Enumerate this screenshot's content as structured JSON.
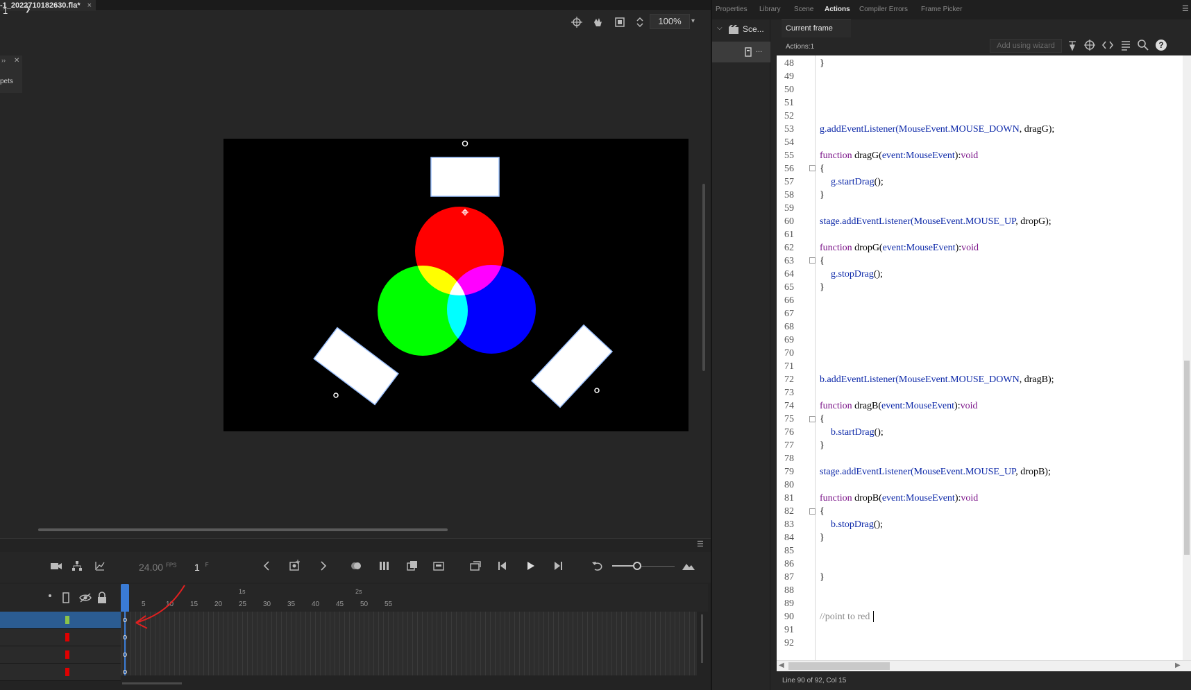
{
  "document": {
    "tab_title": "-1_2022710182630.fla*",
    "tab_close": "×"
  },
  "stage_toolbar": {
    "scene_value": "1",
    "zoom": "100%"
  },
  "workspace": {
    "snippets_label": "pets"
  },
  "timeline": {
    "fps_value": "24.00",
    "fps_unit": "FPS",
    "current_frame": "1",
    "frame_unit": "F",
    "ruler_numbers": [
      "5",
      "10",
      "15",
      "20",
      "25",
      "30",
      "35",
      "40",
      "45",
      "50",
      "55"
    ],
    "ruler_seconds": [
      "1s",
      "2s"
    ],
    "layer_colors": [
      "#8bc34a",
      "#e00000",
      "#e00000",
      "#e00000"
    ]
  },
  "right_panel": {
    "tabs": [
      "Properties",
      "Library",
      "Scene",
      "Actions",
      "Compiler Errors",
      "Frame Picker"
    ],
    "active_tab": "Actions",
    "scene_tree_label": "Sce...",
    "scene_tree_sub": "...",
    "current_frame_tab": "Current frame",
    "actions_label": "Actions:1",
    "wizard_button": "Add using wizard",
    "status": "Line 90 of 92, Col 15"
  },
  "code": {
    "line_numbers": [
      "48",
      "49",
      "50",
      "51",
      "52",
      "53",
      "54",
      "55",
      "56",
      "57",
      "58",
      "59",
      "60",
      "61",
      "62",
      "63",
      "64",
      "65",
      "66",
      "67",
      "68",
      "69",
      "70",
      "71",
      "72",
      "73",
      "74",
      "75",
      "76",
      "77",
      "78",
      "79",
      "80",
      "81",
      "82",
      "83",
      "84",
      "85",
      "86",
      "87",
      "88",
      "89",
      "90",
      "91",
      "92"
    ],
    "lines": {
      "l48": "}",
      "l53a": "g.addEventListener",
      "l53b": "(MouseEvent.MOUSE_DOWN",
      "l53c": ", dragG);",
      "l55a": "function",
      "l55b": " dragG(",
      "l55c": "event:MouseEvent",
      "l55d": "):",
      "l55e": "void",
      "l56": "{",
      "l57a": "g.startDrag",
      "l57b": "();",
      "l58": "}",
      "l60a": "stage.addEventListener",
      "l60b": "(MouseEvent.MOUSE_UP",
      "l60c": ", dropG);",
      "l62a": "function",
      "l62b": " dropG(",
      "l62c": "event:MouseEvent",
      "l62d": "):",
      "l62e": "void",
      "l63": "{",
      "l64a": "g.stopDrag",
      "l64b": "();",
      "l65": "}",
      "l72a": "b.addEventListener",
      "l72b": "(MouseEvent.MOUSE_DOWN",
      "l72c": ", dragB);",
      "l74a": "function",
      "l74b": " dragB(",
      "l74c": "event:MouseEvent",
      "l74d": "):",
      "l74e": "void",
      "l75": "{",
      "l76a": "b.startDrag",
      "l76b": "();",
      "l77": "}",
      "l79a": "stage.addEventListener",
      "l79b": "(MouseEvent.MOUSE_UP",
      "l79c": ", dropB);",
      "l81a": "function",
      "l81b": " dropB(",
      "l81c": "event:MouseEvent",
      "l81d": "):",
      "l81e": "void",
      "l82": "{",
      "l83a": "b.stopDrag",
      "l83b": "();",
      "l84": "}",
      "l87": "}",
      "l90": "//point to red"
    }
  },
  "colors": {
    "red": "#ff0000",
    "green": "#00ff00",
    "blue": "#0000ff",
    "selection": "#2b5c92",
    "playhead": "#3a7bd5",
    "annotation": "#e02020"
  }
}
